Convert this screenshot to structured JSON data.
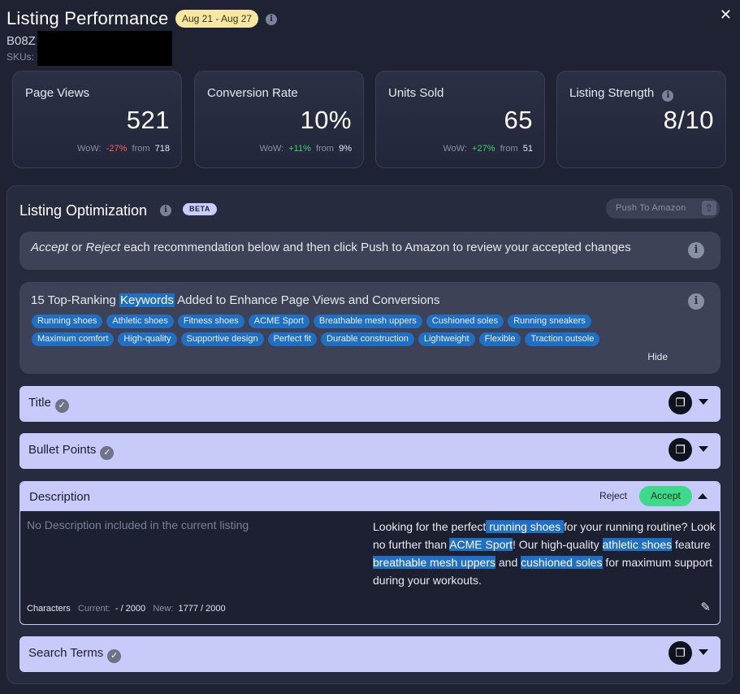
{
  "header": {
    "title": "Listing Performance",
    "date_range": "Aug 21 - Aug 27",
    "asin": "B08Z",
    "skus_label": "SKUs:"
  },
  "metrics": [
    {
      "label": "Page Views",
      "value": "521",
      "wow_label": "WoW:",
      "change": "-27%",
      "change_dir": "neg",
      "from_label": "from",
      "from_value": "718"
    },
    {
      "label": "Conversion Rate",
      "value": "10%",
      "wow_label": "WoW:",
      "change": "+11%",
      "change_dir": "pos",
      "from_label": "from",
      "from_value": "9%"
    },
    {
      "label": "Units Sold",
      "value": "65",
      "wow_label": "WoW:",
      "change": "+27%",
      "change_dir": "pos",
      "from_label": "from",
      "from_value": "51"
    },
    {
      "label": "Listing Strength",
      "value": "8/10"
    }
  ],
  "optimization": {
    "title": "Listing Optimization",
    "beta": "BETA",
    "push_label": "Push To Amazon",
    "instructions_accept": "Accept",
    "instructions_or": " or ",
    "instructions_reject": "Reject",
    "instructions_rest": " each recommendation below and then click Push to Amazon to review your accepted changes",
    "keywords": {
      "title_prefix": "15 Top-Ranking ",
      "title_highlight": "Keywords",
      "title_suffix": " Added to Enhance Page Views and Conversions",
      "row1": [
        "Running shoes",
        "Athletic shoes",
        "Fitness shoes",
        "ACME Sport",
        "Breathable mesh uppers",
        "Cushioned soles",
        "Running sneakers"
      ],
      "row2": [
        "Maximum comfort",
        "High-quality",
        "Supportive design",
        "Perfect fit",
        "Durable construction",
        "Lightweight",
        "Flexible",
        "Traction outsole"
      ],
      "hide_label": "Hide"
    },
    "sections": {
      "title": "Title",
      "bullets": "Bullet Points",
      "description": "Description",
      "search_terms": "Search Terms"
    },
    "description": {
      "reject_label": "Reject",
      "accept_label": "Accept",
      "current_text": "No Description included in the current listing",
      "new_parts": [
        {
          "t": "Looking for the perfect",
          "hl": false
        },
        {
          "t": " running shoes ",
          "hl": true
        },
        {
          "t": "for your running routine? Look no further than ",
          "hl": false
        },
        {
          "t": "ACME Sport",
          "hl": true
        },
        {
          "t": "! Our high-quality ",
          "hl": false
        },
        {
          "t": "athletic shoes",
          "hl": true
        },
        {
          "t": " feature ",
          "hl": false
        },
        {
          "t": "breathable mesh uppers",
          "hl": true
        },
        {
          "t": " and ",
          "hl": false
        },
        {
          "t": "cushioned soles",
          "hl": true
        },
        {
          "t": " for maximum support during your workouts.",
          "hl": false
        }
      ],
      "characters_label": "Characters",
      "current_label": "Current:",
      "current_count": "- / 2000",
      "new_label": "New:",
      "new_count": "1777 / 2000"
    }
  },
  "colors": {
    "background": "#1e2233",
    "highlight": "#1f6fc4",
    "accept": "#3ed98a",
    "negative": "#ff5b5b",
    "positive": "#35d66f",
    "section_bg": "#c8caf9"
  }
}
